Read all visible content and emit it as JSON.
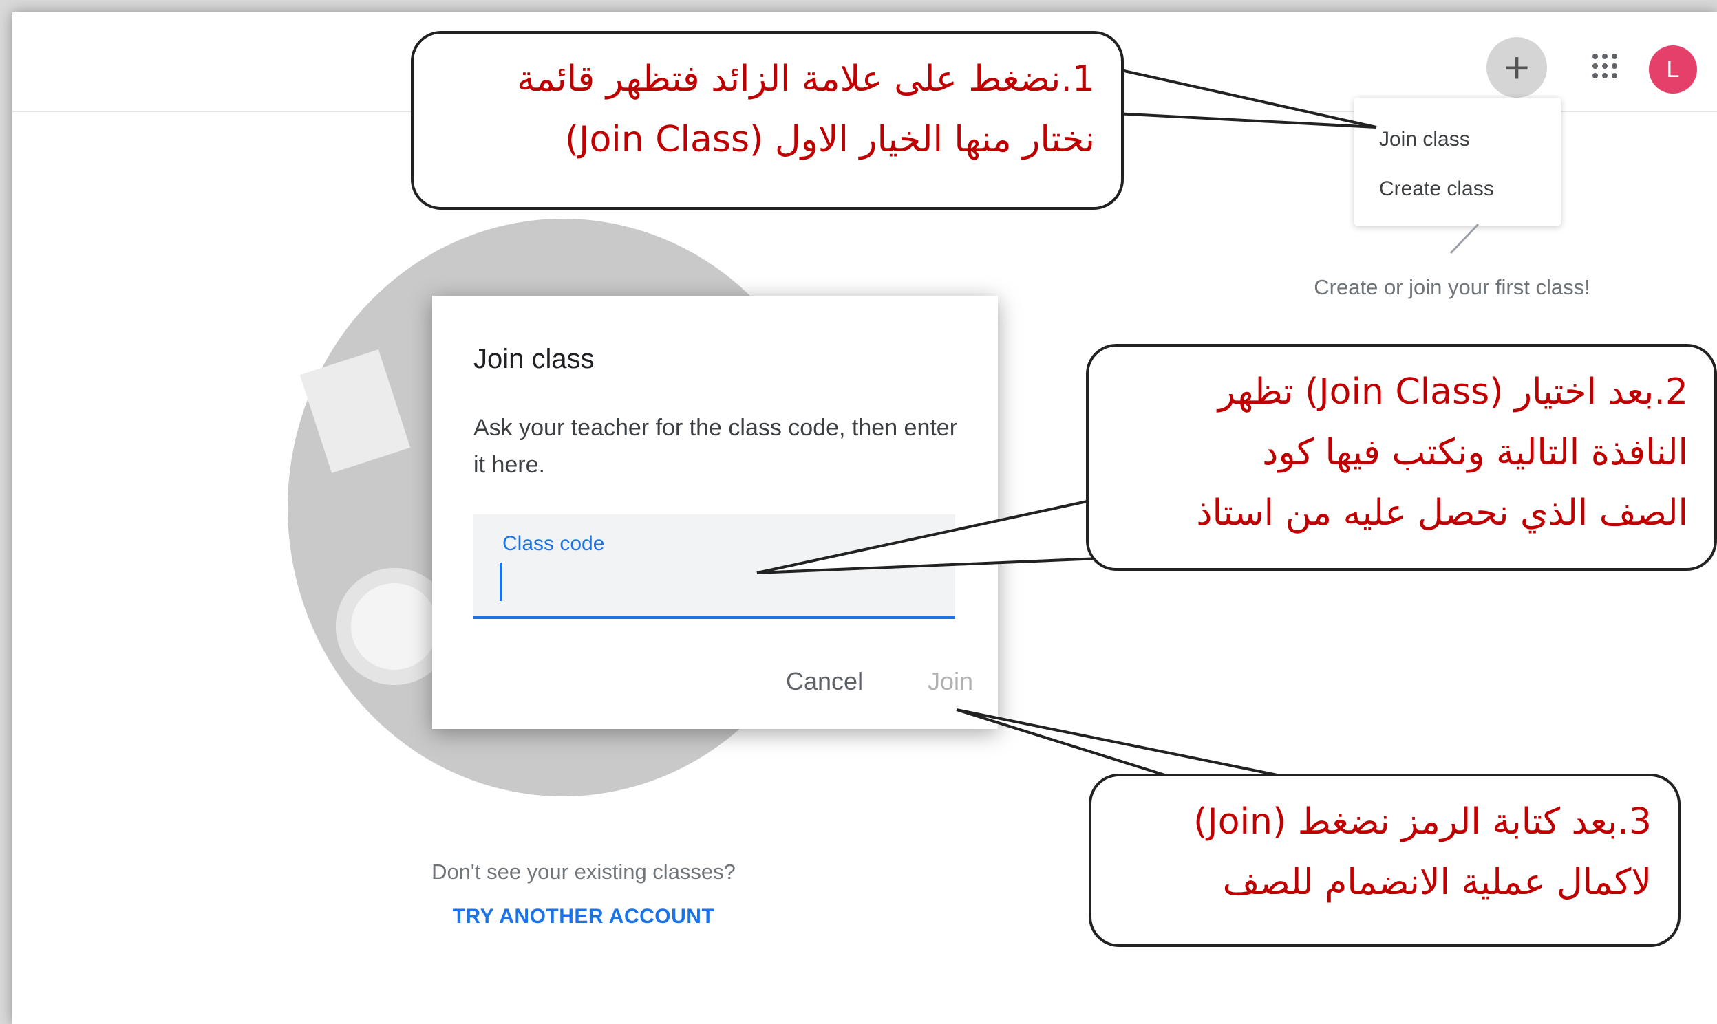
{
  "header": {
    "add_icon_glyph": "+",
    "avatar_initial": "L",
    "avatar_color": "#e5406a"
  },
  "menu": {
    "items": [
      {
        "label": "Join class"
      },
      {
        "label": "Create class"
      }
    ]
  },
  "empty_state": {
    "hint": "Create or join your first class!"
  },
  "dialog": {
    "title": "Join class",
    "description": "Ask your teacher for the class code, then enter it here.",
    "field_label": "Class code",
    "field_value": "",
    "cancel_label": "Cancel",
    "join_label": "Join"
  },
  "footer": {
    "question": "Don't see your existing classes?",
    "link": "TRY ANOTHER ACCOUNT"
  },
  "annotations": {
    "step1": {
      "line1": "1.نضغط على علامة الزائد فتظهر قائمة",
      "line2": "نختار منها الخيار الاول (Join Class)"
    },
    "step2": {
      "line1": "2.بعد اختيار (Join Class) تظهر",
      "line2": "النافذة التالية ونكتب فيها كود",
      "line3": "الصف الذي نحصل عليه من استاذ"
    },
    "step3": {
      "line1": "3.بعد كتابة الرمز نضغط (Join)",
      "line2": "لاكمال عملية الانضمام للصف"
    }
  },
  "colors": {
    "accent": "#1a73e8",
    "annotation_text": "#c00000"
  }
}
